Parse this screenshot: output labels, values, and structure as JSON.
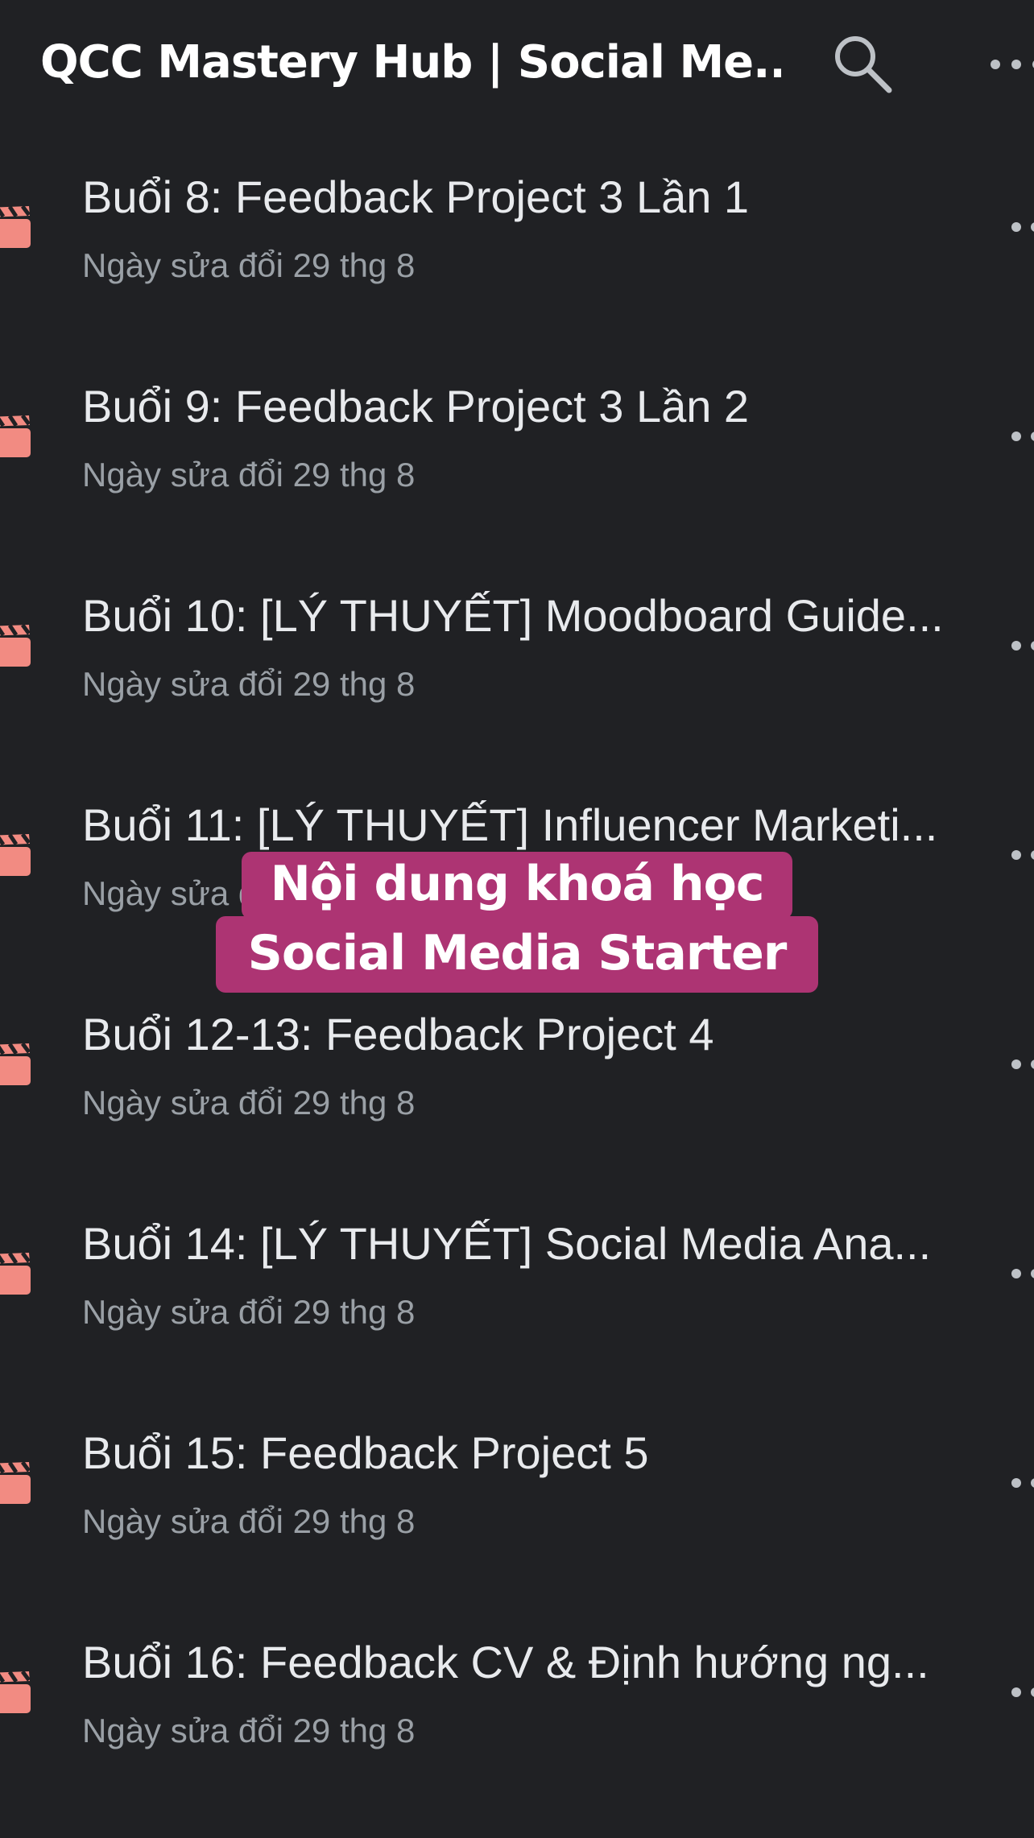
{
  "header": {
    "title": "QCC Mastery Hub | Social Me...",
    "search_icon": "search-icon",
    "more_icon": "more-options-icon"
  },
  "colors": {
    "background": "#202124",
    "file_icon": "#f28b82",
    "overlay_bg": "#ad3473",
    "title_text": "#e8eaed",
    "subtitle_text": "#9aa0a6"
  },
  "files": [
    {
      "title": "Buổi 8: Feedback Project 3 Lần 1",
      "modified": "Ngày sửa đổi 29 thg 8",
      "icon": "video-file-icon"
    },
    {
      "title": "Buổi 9: Feedback Project 3 Lần 2",
      "modified": "Ngày sửa đổi 29 thg 8",
      "icon": "video-file-icon"
    },
    {
      "title": "Buổi 10: [LÝ THUYẾT] Moodboard Guide...",
      "modified": "Ngày sửa đổi 29 thg 8",
      "icon": "video-file-icon"
    },
    {
      "title": "Buổi 11: [LÝ THUYẾT] Influencer Marketi...",
      "modified": "Ngày sửa đổi 29 thg 8",
      "icon": "video-file-icon"
    },
    {
      "title": "Buổi 12-13: Feedback Project 4",
      "modified": "Ngày sửa đổi 29 thg 8",
      "icon": "video-file-icon"
    },
    {
      "title": "Buổi 14: [LÝ THUYẾT] Social Media Ana...",
      "modified": "Ngày sửa đổi 29 thg 8",
      "icon": "video-file-icon"
    },
    {
      "title": "Buổi 15: Feedback Project 5",
      "modified": "Ngày sửa đổi 29 thg 8",
      "icon": "video-file-icon"
    },
    {
      "title": "Buổi 16: Feedback CV & Định hướng ng...",
      "modified": "Ngày sửa đổi 29 thg 8",
      "icon": "video-file-icon"
    }
  ],
  "overlay": {
    "line1": "Nội dung khoá học",
    "line2": "Social Media Starter"
  }
}
